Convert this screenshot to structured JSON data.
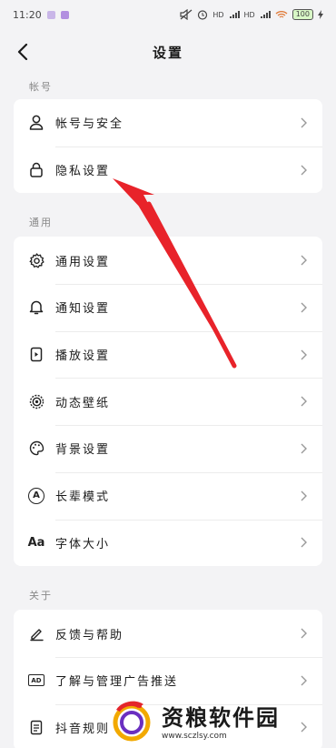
{
  "status_bar": {
    "time": "11:20",
    "signal1_label": "HD",
    "signal2_label": "HD",
    "battery_text": "100"
  },
  "header": {
    "title": "设置"
  },
  "sections": [
    {
      "label": "帐号",
      "items": [
        {
          "label": "帐号与安全",
          "icon": "person-icon"
        },
        {
          "label": "隐私设置",
          "icon": "lock-icon"
        }
      ]
    },
    {
      "label": "通用",
      "items": [
        {
          "label": "通用设置",
          "icon": "gear-icon"
        },
        {
          "label": "通知设置",
          "icon": "bell-icon"
        },
        {
          "label": "播放设置",
          "icon": "play-device-icon"
        },
        {
          "label": "动态壁纸",
          "icon": "live-wallpaper-icon"
        },
        {
          "label": "背景设置",
          "icon": "palette-icon"
        },
        {
          "label": "长辈模式",
          "icon": "elder-mode-icon"
        },
        {
          "label": "字体大小",
          "icon": "font-size-icon"
        }
      ]
    },
    {
      "label": "关于",
      "items": [
        {
          "label": "反馈与帮助",
          "icon": "pen-icon"
        },
        {
          "label": "了解与管理广告推送",
          "icon": "ad-icon"
        },
        {
          "label": "抖音规则",
          "icon": "document-icon"
        }
      ]
    }
  ],
  "font_icon_text": "Aa",
  "ad_icon_text": "AD",
  "elder_icon_text": "A",
  "watermark": {
    "title": "资粮软件园",
    "url": "www.sczlsy.com"
  },
  "annotation": {
    "arrow_color": "#e8232a"
  }
}
